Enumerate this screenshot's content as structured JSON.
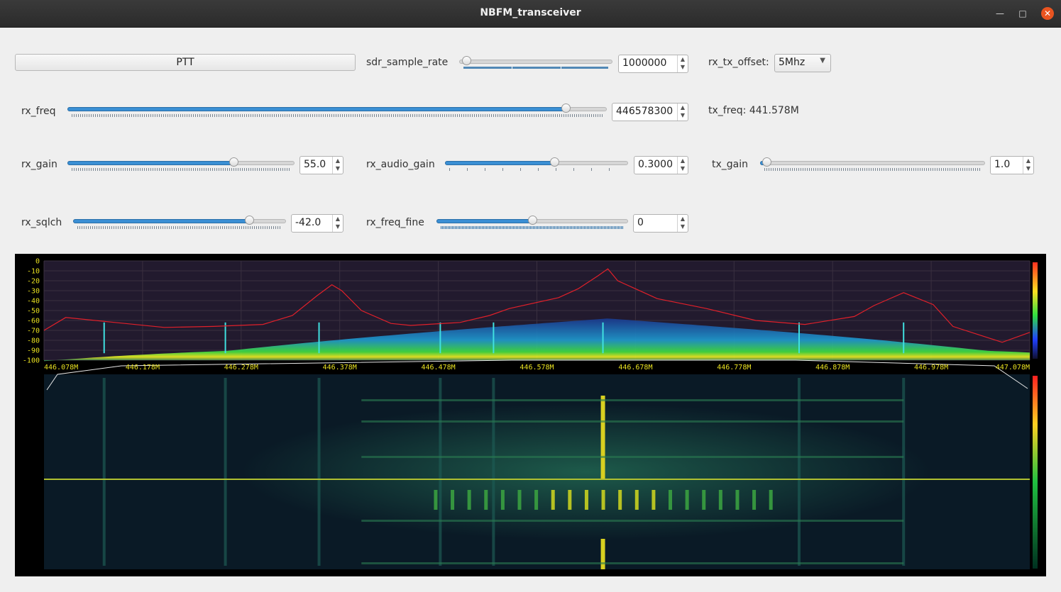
{
  "window": {
    "title": "NBFM_transceiver",
    "minimize_icon": "minimize-icon",
    "maximize_icon": "maximize-icon",
    "close_icon": "close-icon"
  },
  "controls": {
    "ptt": {
      "label": "PTT"
    },
    "sdr_sample_rate": {
      "label": "sdr_sample_rate",
      "value": "1000000",
      "level": 0.02
    },
    "rx_tx_offset": {
      "label": "rx_tx_offset:",
      "selected": "5Mhz"
    },
    "rx_freq": {
      "label": "rx_freq",
      "value": "446578300",
      "level": 0.93
    },
    "tx_freq": {
      "text": "tx_freq: 441.578M"
    },
    "rx_gain": {
      "label": "rx_gain",
      "value": "55.0",
      "level": 0.74
    },
    "rx_audio_gain": {
      "label": "rx_audio_gain",
      "value": "0.3000",
      "level": 0.6
    },
    "tx_gain": {
      "label": "tx_gain",
      "value": "1.0",
      "level": 0.01
    },
    "rx_sqlch": {
      "label": "rx_sqlch",
      "value": "-42.0",
      "level": 0.84
    },
    "rx_freq_fine": {
      "label": "rx_freq_fine",
      "value": "0",
      "level": 0.5
    }
  },
  "chart_data": {
    "type": "line",
    "y_ticks": [
      "0",
      "-10",
      "-20",
      "-30",
      "-40",
      "-50",
      "-60",
      "-70",
      "-80",
      "-90",
      "-100"
    ],
    "x_ticks": [
      "446.078M",
      "446.178M",
      "446.278M",
      "446.378M",
      "446.478M",
      "446.578M",
      "446.678M",
      "446.778M",
      "446.878M",
      "446.978M",
      "447.078M"
    ],
    "ylim": [
      -100,
      0
    ],
    "xlim": [
      446.078,
      447.078
    ],
    "grid": true,
    "series": [
      {
        "color": "#e0202a",
        "x": [
          446.078,
          446.1,
          446.15,
          446.2,
          446.25,
          446.3,
          446.33,
          446.355,
          446.37,
          446.38,
          446.4,
          446.43,
          446.45,
          446.5,
          446.53,
          446.55,
          446.6,
          446.62,
          446.64,
          446.65,
          446.66,
          446.7,
          446.75,
          446.8,
          446.85,
          446.9,
          446.92,
          446.95,
          446.98,
          447.0,
          447.05,
          447.078
        ],
        "y": [
          -70,
          -57,
          -62,
          -67,
          -66,
          -64,
          -55,
          -35,
          -24,
          -30,
          -50,
          -63,
          -65,
          -62,
          -55,
          -48,
          -37,
          -28,
          -15,
          -8,
          -20,
          -38,
          -48,
          -60,
          -64,
          -56,
          -45,
          -32,
          -44,
          -66,
          -82,
          -72
        ]
      }
    ],
    "waterfall": {
      "colorbar": "blue-green-yellow-red",
      "center_freq": "446.578M"
    }
  }
}
